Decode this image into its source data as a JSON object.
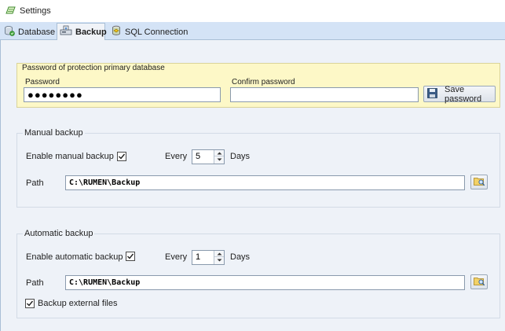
{
  "window": {
    "title": "Settings",
    "icon": "settings-app-icon"
  },
  "tabs": [
    {
      "label": "Database",
      "icon": "database-icon",
      "active": false
    },
    {
      "label": "Backup",
      "icon": "backup-icon",
      "active": true
    },
    {
      "label": "SQL Connection",
      "icon": "sql-connection-icon",
      "active": false
    }
  ],
  "password_panel": {
    "title": "Password of protection primary database",
    "password_label": "Password",
    "password_value": "●●●●●●●●",
    "confirm_label": "Confirm password",
    "confirm_value": "",
    "save_button": "Save password",
    "save_icon": "save-disk-icon"
  },
  "manual_backup": {
    "title": "Manual backup",
    "enable_label": "Enable manual backup",
    "enabled": true,
    "every_label": "Every",
    "interval": "5",
    "unit_label": "Days",
    "path_label": "Path",
    "path_value": "C:\\RUMEN\\Backup",
    "browse_icon": "browse-folder-icon"
  },
  "automatic_backup": {
    "title": "Automatic backup",
    "enable_label": "Enable automatic backup",
    "enabled": true,
    "every_label": "Every",
    "interval": "1",
    "unit_label": "Days",
    "path_label": "Path",
    "path_value": "C:\\RUMEN\\Backup",
    "browse_icon": "browse-folder-icon",
    "external_files_label": "Backup external files",
    "external_files": true
  },
  "colors": {
    "tab_strip": "#d4e3f6",
    "content_bg": "#eef2f8",
    "password_panel_bg": "#fdf8c7"
  }
}
